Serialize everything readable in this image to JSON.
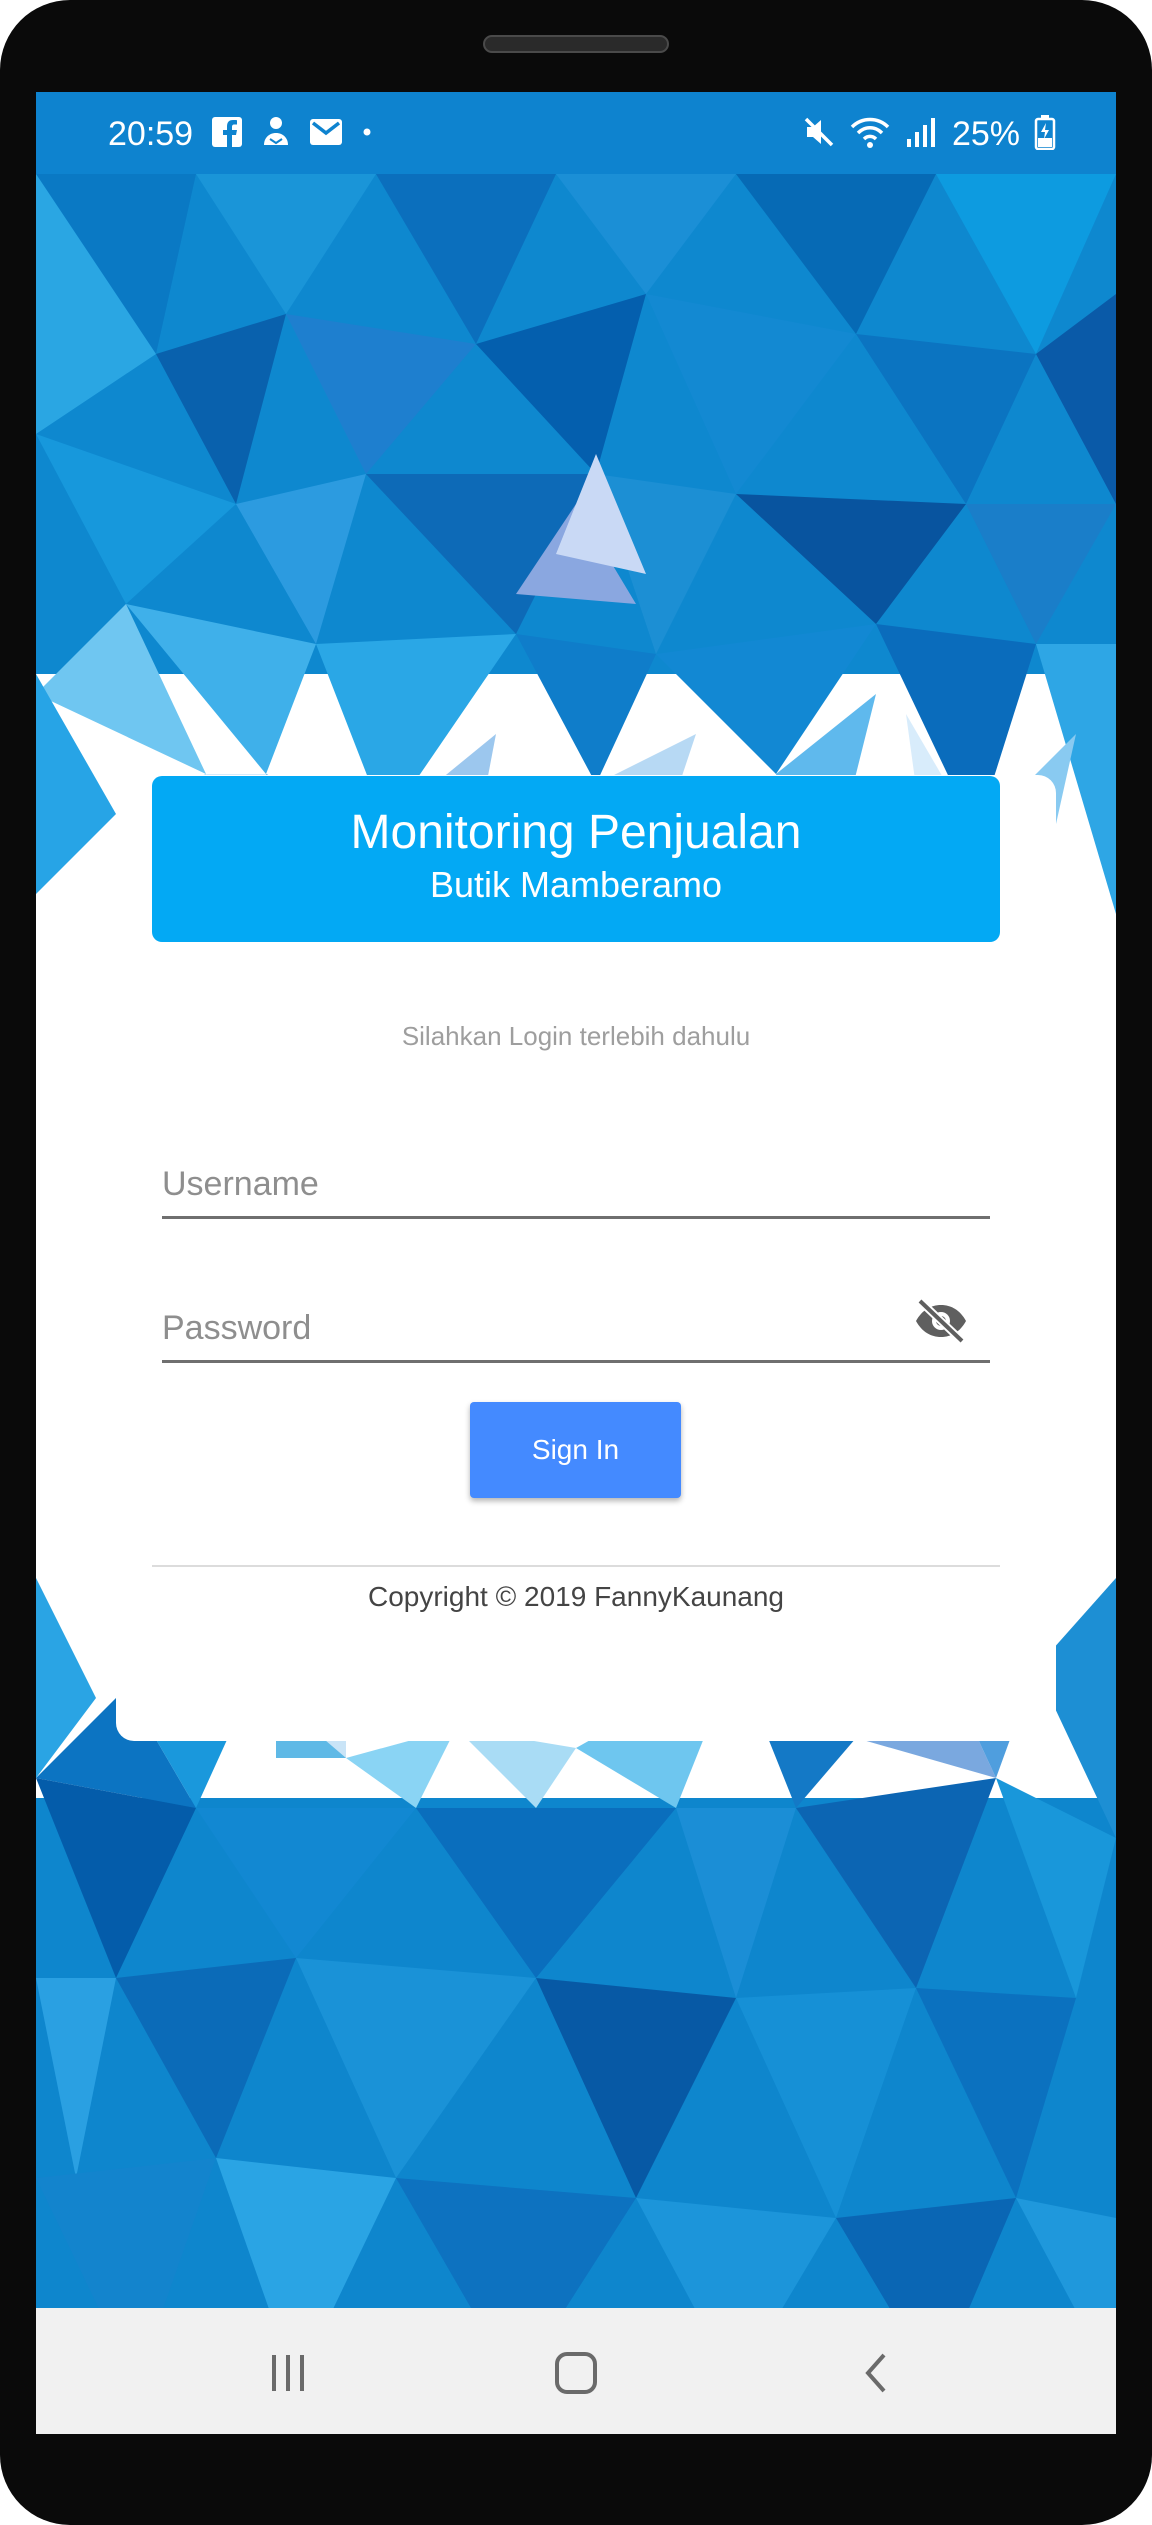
{
  "status_bar": {
    "time": "20:59",
    "notification_icons": [
      "facebook-icon",
      "contact-icon",
      "mail-icon",
      "dot-icon"
    ],
    "system_icons": [
      "mute-icon",
      "wifi-icon",
      "signal-icon",
      "battery-charging-icon"
    ],
    "battery": "25%"
  },
  "banner": {
    "title": "Monitoring Penjualan",
    "subtitle": "Butik Mamberamo"
  },
  "login": {
    "hint": "Silahkan Login terlebih dahulu",
    "username_placeholder": "Username",
    "password_placeholder": "Password",
    "toggle_icon": "eye-off-icon",
    "signin_label": "Sign In"
  },
  "footer": {
    "copyright": "Copyright © 2019 FannyKaunang"
  },
  "nav_bar": {
    "buttons": [
      "recent-apps-icon",
      "home-icon",
      "back-icon"
    ]
  },
  "colors": {
    "status_bar": "#0e83cf",
    "banner": "#03a9f4",
    "button": "#448aff",
    "background_blue": "#0288d1",
    "device_frame": "#0a0a0a"
  }
}
